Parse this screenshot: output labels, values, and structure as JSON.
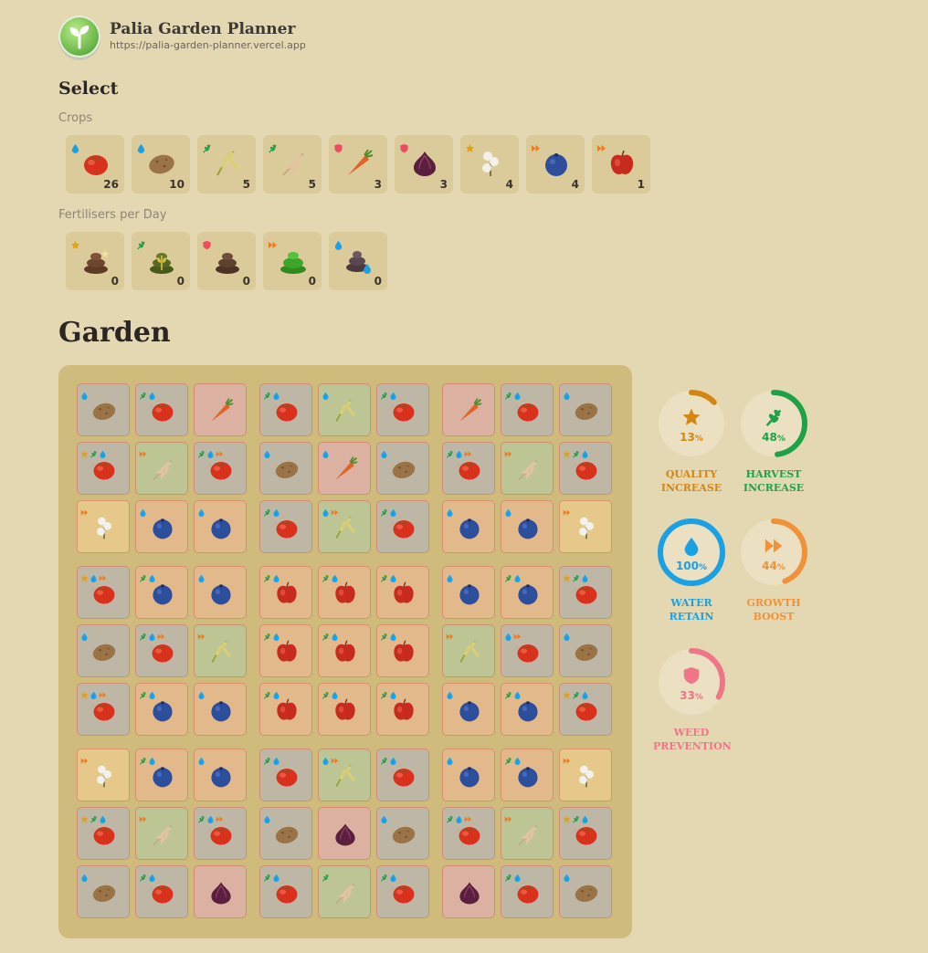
{
  "app": {
    "title": "Palia Garden Planner",
    "url": "https://palia-garden-planner.vercel.app"
  },
  "select": {
    "heading": "Select",
    "crops_label": "Crops",
    "crops": [
      {
        "name": "tomato",
        "badge": "water",
        "count": "26"
      },
      {
        "name": "potato",
        "badge": "water",
        "count": "10"
      },
      {
        "name": "rice",
        "badge": "harvest",
        "count": "5"
      },
      {
        "name": "wheat",
        "badge": "harvest",
        "count": "5"
      },
      {
        "name": "carrot",
        "badge": "weed",
        "count": "3"
      },
      {
        "name": "onion",
        "badge": "weed",
        "count": "3"
      },
      {
        "name": "cotton",
        "badge": "quality",
        "count": "4"
      },
      {
        "name": "blueberry",
        "badge": "growth",
        "count": "4"
      },
      {
        "name": "apple",
        "badge": "growth",
        "count": "1"
      }
    ],
    "fertilisers_label": "Fertilisers per Day",
    "fertilisers": [
      {
        "name": "quality-fertiliser",
        "badge": "quality",
        "count": "0"
      },
      {
        "name": "harvest-fertiliser",
        "badge": "harvest",
        "count": "0"
      },
      {
        "name": "weed-fertiliser",
        "badge": "weed",
        "count": "0"
      },
      {
        "name": "growth-fertiliser",
        "badge": "growth",
        "count": "0"
      },
      {
        "name": "water-fertiliser",
        "badge": "water",
        "count": "0"
      }
    ]
  },
  "garden": {
    "heading": "Garden",
    "rows": [
      [
        "potato:w:gray",
        "tomato:hw:gray",
        "carrot::pink",
        "tomato:hw:gray",
        "rice:w:green",
        "tomato:hw:gray",
        "carrot::pink",
        "tomato:hw:gray",
        "potato:w:gray"
      ],
      [
        "tomato:qhw:gray",
        "wheat:g:green",
        "tomato:hwg:gray",
        "potato:w:gray",
        "carrot:w:pink",
        "potato:w:gray",
        "tomato:hwg:gray",
        "wheat:g:green",
        "tomato:qhw:gray"
      ],
      [
        "cotton:g:yellow",
        "blueberry:w:orange",
        "blueberry:w:orange",
        "tomato:hw:gray",
        "rice:wg:green",
        "tomato:hw:gray",
        "blueberry:w:orange",
        "blueberry:w:orange",
        "cotton:g:yellow"
      ],
      [
        "tomato:qwg:gray",
        "blueberry:hw:orange",
        "blueberry:w:orange",
        "apple:hw:orange",
        "apple:hw:orange",
        "apple:hw:orange",
        "blueberry:w:orange",
        "blueberry:hw:orange",
        "tomato:qhw:gray"
      ],
      [
        "potato:w:gray",
        "tomato:hwg:gray",
        "rice:g:green",
        "apple:hw:orange",
        "apple:hw:orange",
        "apple:hw:orange",
        "rice:g:green",
        "tomato:wg:gray",
        "potato:w:gray"
      ],
      [
        "tomato:qwg:gray",
        "blueberry:hw:orange",
        "blueberry:w:orange",
        "apple:hw:orange",
        "apple:hw:orange",
        "apple:hw:orange",
        "blueberry:w:orange",
        "blueberry:hw:orange",
        "tomato:qhw:gray"
      ],
      [
        "cotton:g:yellow",
        "blueberry:hw:orange",
        "blueberry:w:orange",
        "tomato:hw:gray",
        "rice:wg:green",
        "tomato:hw:gray",
        "blueberry:w:orange",
        "blueberry:hw:orange",
        "cotton:g:yellow"
      ],
      [
        "tomato:qhw:gray",
        "wheat:g:green",
        "tomato:hwg:gray",
        "potato:w:gray",
        "onion::pink",
        "potato:w:gray",
        "tomato:hwg:gray",
        "wheat:g:green",
        "tomato:qhw:gray"
      ],
      [
        "potato:w:gray",
        "tomato:hw:gray",
        "onion::pink",
        "tomato:hw:gray",
        "wheat:h:green",
        "tomato:hw:gray",
        "onion::pink",
        "tomato:hw:gray",
        "potato:w:gray"
      ]
    ]
  },
  "stats": [
    {
      "key": "quality",
      "value": "13",
      "unit": "%",
      "fraction": 0.13,
      "label1": "QUALITY",
      "label2": "INCREASE",
      "color": "#d48512"
    },
    {
      "key": "harvest",
      "value": "48",
      "unit": "%",
      "fraction": 0.48,
      "label1": "HARVEST",
      "label2": "INCREASE",
      "color": "#1fa247"
    },
    {
      "key": "water",
      "value": "100",
      "unit": "%",
      "fraction": 1.0,
      "label1": "WATER",
      "label2": "RETAIN",
      "color": "#1aa1e4"
    },
    {
      "key": "growth",
      "value": "44",
      "unit": "%",
      "fraction": 0.44,
      "label1": "GROWTH",
      "label2": "BOOST",
      "color": "#f0923a"
    },
    {
      "key": "weed",
      "value": "33",
      "unit": "%",
      "fraction": 0.33,
      "label1": "WEED",
      "label2": "PREVENTION",
      "color": "#ef7689"
    }
  ],
  "colors": {
    "water": "#1aa1e4",
    "harvest": "#1fa247",
    "weed": "#ef4b61",
    "quality": "#e3a012",
    "growth": "#f07a20"
  }
}
